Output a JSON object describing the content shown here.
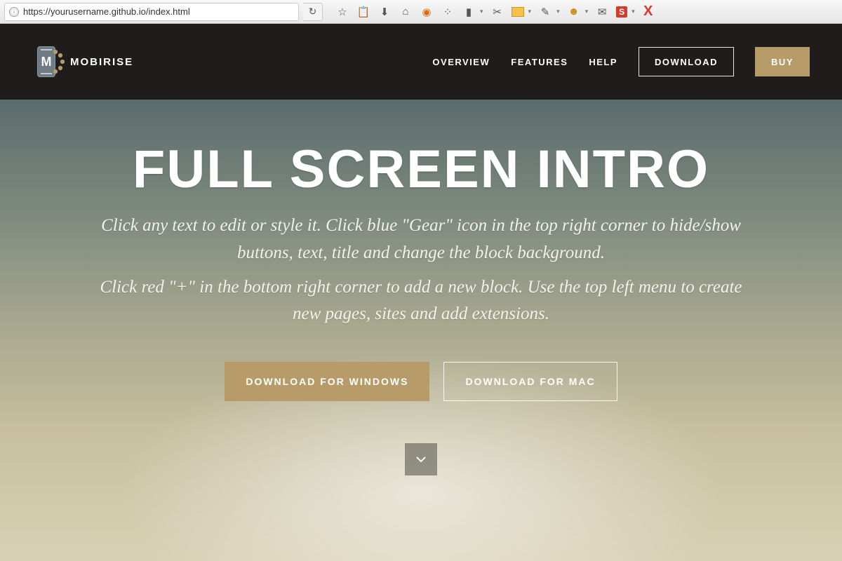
{
  "browser": {
    "url": "https://yourusername.github.io/index.html",
    "info_glyph": "ⓘ",
    "reload_glyph": "↻",
    "icons": {
      "star": "☆",
      "clipboard": "📋",
      "download": "⬇",
      "home": "⌂",
      "duck": "◉",
      "colorballs": "⁘",
      "battery": "▮",
      "dropdown": "▾",
      "pin": "✂",
      "picker": "✎",
      "face": "☻",
      "chat": "✉",
      "s_badge": "S",
      "x_badge": "X"
    }
  },
  "header": {
    "brand": "MOBIRISE",
    "logo_letter": "M",
    "nav": {
      "overview": "OVERVIEW",
      "features": "FEATURES",
      "help": "HELP"
    },
    "download": "DOWNLOAD",
    "buy": "BUY"
  },
  "hero": {
    "title": "FULL SCREEN INTRO",
    "p1": "Click any text to edit or style it. Click blue \"Gear\" icon in the top right corner to hide/show buttons, text, title and change the block background.",
    "p2": "Click red \"+\" in the bottom right corner to add a new block. Use the top left menu to create new pages, sites and add extensions.",
    "btn_windows": "DOWNLOAD FOR WINDOWS",
    "btn_mac": "DOWNLOAD FOR MAC"
  },
  "colors": {
    "header_bg": "#1f1d1b",
    "accent_gold": "#b79c6a"
  }
}
